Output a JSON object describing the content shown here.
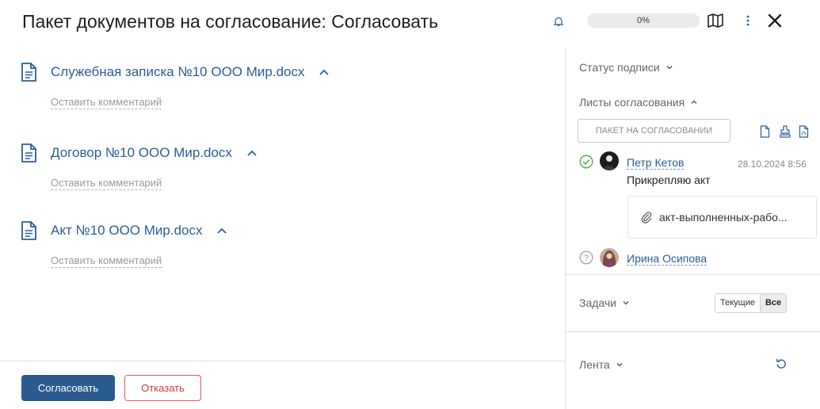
{
  "header": {
    "title": "Пакет документов на согласование: Согласовать",
    "progress_label": "0%",
    "icons": [
      "bell-icon",
      "map-icon",
      "more-vertical-icon",
      "close-icon"
    ]
  },
  "documents": [
    {
      "name": "Служебная записка №10 ООО Мир.docx",
      "comment_label": "Оставить комментарий"
    },
    {
      "name": "Договор №10 ООО Мир.docx",
      "comment_label": "Оставить комментарий"
    },
    {
      "name": "Акт №10 ООО Мир.docx",
      "comment_label": "Оставить комментарий"
    }
  ],
  "footer": {
    "approve_label": "Согласовать",
    "reject_label": "Отказать"
  },
  "right_panel": {
    "signature_status_label": "Статус подписи",
    "approval_sheets_label": "Листы согласования",
    "sheet_button_label": "ПАКЕТ НА СОГЛАСОВАНИИ",
    "approvals": [
      {
        "name": "Петр Кетов",
        "status": "approved",
        "timestamp": "28.10.2024 8:56",
        "comment": "Прикрепляю акт",
        "attachment": "акт-выполненных-рабо..."
      },
      {
        "name": "Ирина Осипова",
        "status": "pending"
      }
    ],
    "tasks_label": "Задачи",
    "tasks_filter": {
      "current_label": "Текущие",
      "all_label": "Все",
      "selected": "Все"
    },
    "feed_label": "Лента"
  },
  "colors": {
    "accent": "#2b5c8f",
    "link": "#2a5d97",
    "reject": "#d23a3a",
    "success": "#3cb043"
  }
}
